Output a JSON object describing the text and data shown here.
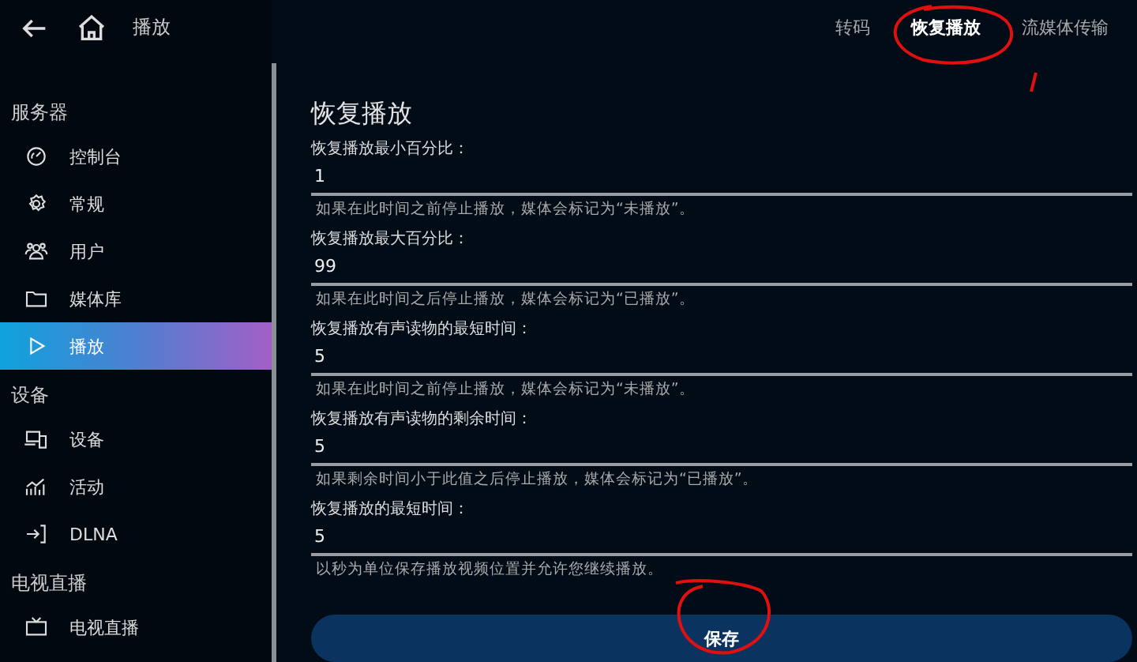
{
  "header": {
    "title": "播放"
  },
  "tabs": [
    {
      "label": "转码",
      "selected": false
    },
    {
      "label": "恢复播放",
      "selected": true
    },
    {
      "label": "流媒体传输",
      "selected": false
    }
  ],
  "sidebar": {
    "sections": [
      {
        "heading": "服务器",
        "items": [
          {
            "label": "控制台",
            "kind": "dashboard",
            "selected": false
          },
          {
            "label": "常规",
            "kind": "gear",
            "selected": false
          },
          {
            "label": "用户",
            "kind": "users",
            "selected": false
          },
          {
            "label": "媒体库",
            "kind": "folder",
            "selected": false
          },
          {
            "label": "播放",
            "kind": "play",
            "selected": true
          }
        ]
      },
      {
        "heading": "设备",
        "items": [
          {
            "label": "设备",
            "kind": "devices",
            "selected": false
          },
          {
            "label": "活动",
            "kind": "activity",
            "selected": false
          },
          {
            "label": "DLNA",
            "kind": "enter",
            "selected": false
          }
        ]
      },
      {
        "heading": "电视直播",
        "items": [
          {
            "label": "电视直播",
            "kind": "tv",
            "selected": false
          }
        ]
      }
    ]
  },
  "section_title": "恢复播放",
  "fields": [
    {
      "label": "恢复播放最小百分比：",
      "value": "1",
      "hint": "如果在此时间之前停止播放，媒体会标记为“未播放”。"
    },
    {
      "label": "恢复播放最大百分比：",
      "value": "99",
      "hint": "如果在此时间之后停止播放，媒体会标记为“已播放”。"
    },
    {
      "label": "恢复播放有声读物的最短时间：",
      "value": "5",
      "hint": "如果在此时间之前停止播放，媒体会标记为“未播放”。"
    },
    {
      "label": "恢复播放有声读物的剩余时间：",
      "value": "5",
      "hint": "如果剩余时间小于此值之后停止播放，媒体会标记为“已播放”。"
    },
    {
      "label": "恢复播放的最短时间：",
      "value": "5",
      "hint": "以秒为单位保存播放视频位置并允许您继续播放。"
    }
  ],
  "save_button": "保存"
}
